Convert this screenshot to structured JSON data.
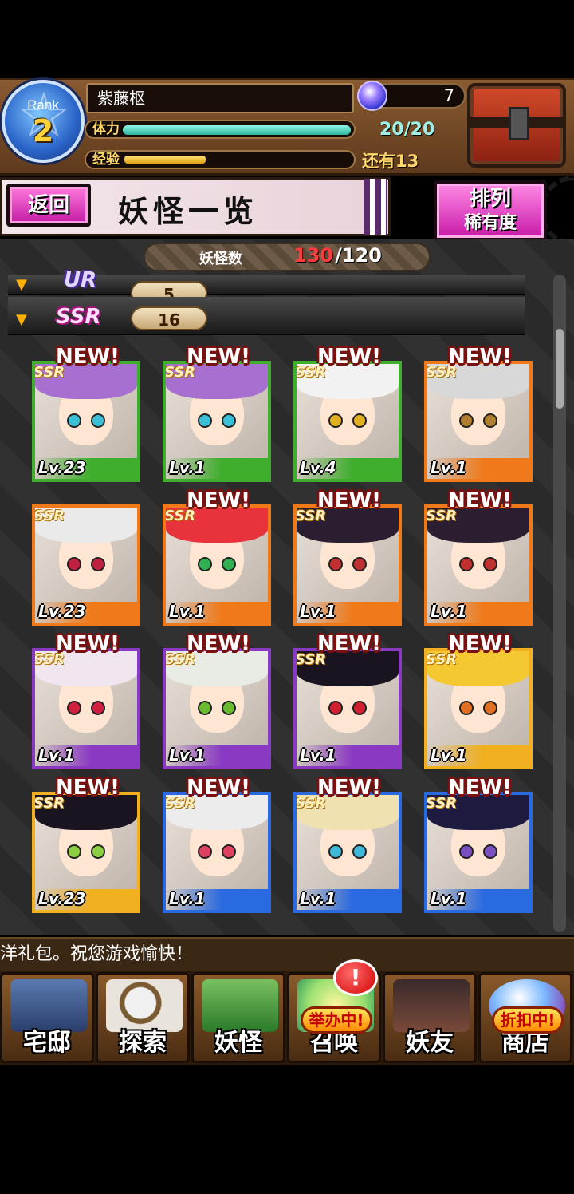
{
  "player": {
    "rank_label": "Rank",
    "rank": "2",
    "name": "紫藤枢",
    "stamina_label": "体力",
    "stamina_text": "20/20",
    "stamina_fraction": 1.0,
    "exp_label": "经验",
    "exp_remaining_text": "还有13",
    "exp_fraction": 0.36,
    "gems": "7"
  },
  "titlebar": {
    "back_label": "返回",
    "title": "妖怪一览",
    "sort_label": "排列",
    "sort_value": "稀有度"
  },
  "collection": {
    "count_label": "妖怪数",
    "count_current": "130",
    "count_max": "/120"
  },
  "rarity_groups": [
    {
      "rarity": "UR",
      "count": "5"
    },
    {
      "rarity": "SSR",
      "count": "16"
    }
  ],
  "cards": [
    {
      "level": "Lv.23",
      "rarity": "SSR",
      "new": "NEW!",
      "frame": "#3fae2c",
      "hair": "#a66fd0",
      "eye": "#3bbfd6"
    },
    {
      "level": "Lv.1",
      "rarity": "SSR",
      "new": "NEW!",
      "frame": "#3fae2c",
      "hair": "#a66fd0",
      "eye": "#3bbfd6"
    },
    {
      "level": "Lv.4",
      "rarity": "SSR",
      "new": "NEW!",
      "frame": "#3fae2c",
      "hair": "#f2f2f2",
      "eye": "#e0b020"
    },
    {
      "level": "Lv.1",
      "rarity": "SSR",
      "new": "NEW!",
      "frame": "#f07a1a",
      "hair": "#d8d8d8",
      "eye": "#b08030"
    },
    {
      "level": "Lv.23",
      "rarity": "SSR",
      "new": "",
      "frame": "#f07a1a",
      "hair": "#eaeaea",
      "eye": "#c02040"
    },
    {
      "level": "Lv.1",
      "rarity": "SSR",
      "new": "NEW!",
      "frame": "#f07a1a",
      "hair": "#e8323c",
      "eye": "#30b050"
    },
    {
      "level": "Lv.1",
      "rarity": "SSR",
      "new": "NEW!",
      "frame": "#f07a1a",
      "hair": "#2a1e30",
      "eye": "#c03030"
    },
    {
      "level": "Lv.1",
      "rarity": "SSR",
      "new": "NEW!",
      "frame": "#f07a1a",
      "hair": "#2a1e30",
      "eye": "#c03030"
    },
    {
      "level": "Lv.1",
      "rarity": "SSR",
      "new": "NEW!",
      "frame": "#8a3ac2",
      "hair": "#f0e6f0",
      "eye": "#d02040"
    },
    {
      "level": "Lv.1",
      "rarity": "SSR",
      "new": "NEW!",
      "frame": "#8a3ac2",
      "hair": "#e8ece4",
      "eye": "#6aba30"
    },
    {
      "level": "Lv.1",
      "rarity": "SSR",
      "new": "NEW!",
      "frame": "#8a3ac2",
      "hair": "#1a1420",
      "eye": "#d02030"
    },
    {
      "level": "Lv.1",
      "rarity": "SSR",
      "new": "NEW!",
      "frame": "#f0b020",
      "hair": "#f4c830",
      "eye": "#e07020"
    },
    {
      "level": "Lv.23",
      "rarity": "SSR",
      "new": "NEW!",
      "frame": "#f0b020",
      "hair": "#1a1420",
      "eye": "#8ad040"
    },
    {
      "level": "Lv.1",
      "rarity": "SSR",
      "new": "NEW!",
      "frame": "#2a6ae0",
      "hair": "#ececec",
      "eye": "#e04060"
    },
    {
      "level": "Lv.1",
      "rarity": "SSR",
      "new": "NEW!",
      "frame": "#2a6ae0",
      "hair": "#efe2b0",
      "eye": "#40b8d8"
    },
    {
      "level": "Lv.1",
      "rarity": "SSR",
      "new": "NEW!",
      "frame": "#2a6ae0",
      "hair": "#1e1a40",
      "eye": "#7a50c0"
    }
  ],
  "ticker": "洋礼包。祝您游戏愉快！",
  "nav": [
    {
      "label": "宅邸",
      "icon": "mansion-icon",
      "badge": ""
    },
    {
      "label": "探索",
      "icon": "magnifier-map-icon",
      "badge": ""
    },
    {
      "label": "妖怪",
      "icon": "yokai-scroll-icon",
      "badge": ""
    },
    {
      "label": "召唤",
      "icon": "summon-star-icon",
      "badge": "举办中!"
    },
    {
      "label": "妖友",
      "icon": "friend-catgirl-icon",
      "badge": ""
    },
    {
      "label": "商店",
      "icon": "shop-orb-icon",
      "badge": "折扣中!"
    }
  ],
  "summon_alert": "!"
}
